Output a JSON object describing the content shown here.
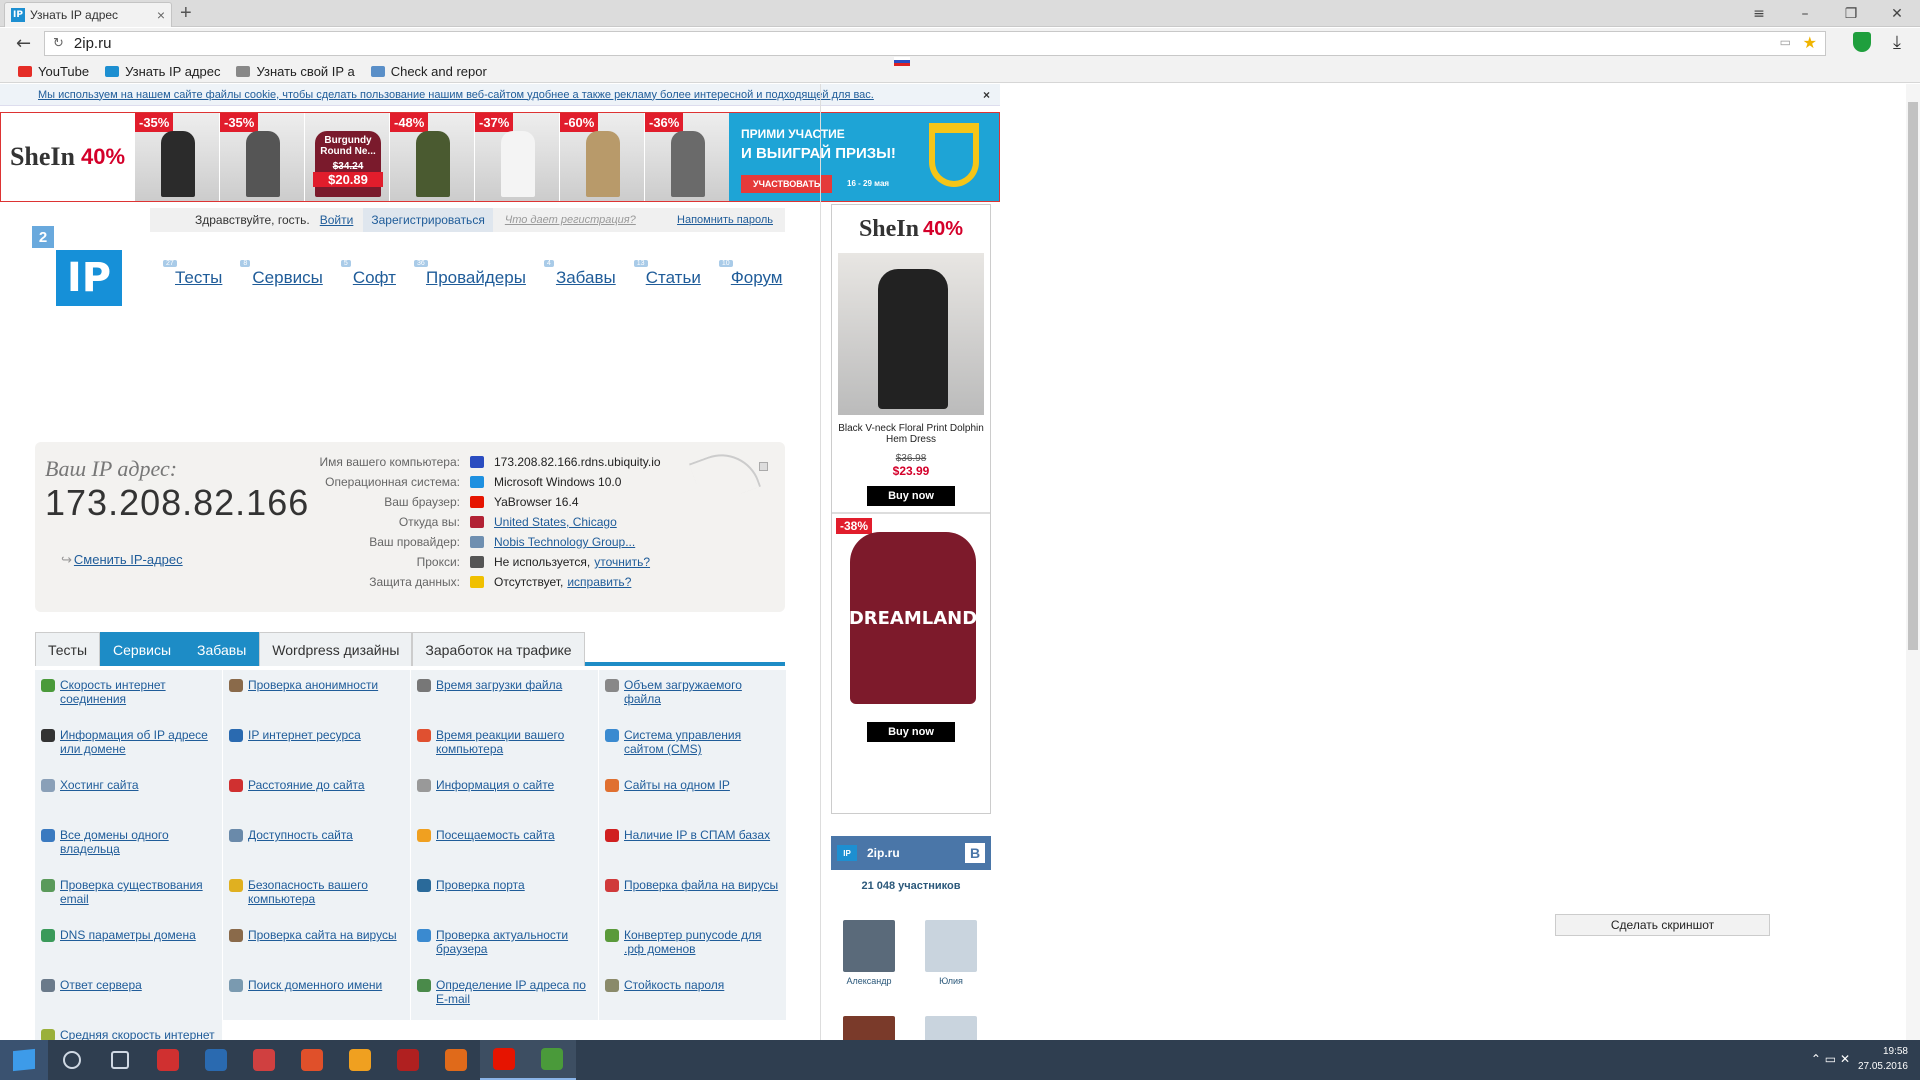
{
  "browser": {
    "tab_title": "Узнать IP адрес",
    "favicon_text": "IP",
    "close_glyph": "×",
    "newtab_glyph": "+",
    "address": "2ip.ru",
    "window_controls": [
      "≡",
      "–",
      "❐",
      "✕"
    ],
    "bookmarks": [
      {
        "label": "YouTube",
        "color": "#e52d27"
      },
      {
        "label": "Узнать IP адрес",
        "color": "#1d8fd1"
      },
      {
        "label": "Узнать свой IP а",
        "color": "#888888"
      },
      {
        "label": "Check and repor",
        "color": "#5a8fc8"
      }
    ]
  },
  "cookie_notice": {
    "text": "Мы используем на нашем сайте файлы cookie, чтобы сделать пользование нашим веб-сайтом удобнее а также рекламу более интересной и подходящей для вас.",
    "close": "×"
  },
  "banner": {
    "brand": "SheIn",
    "percent": "40%",
    "products": [
      {
        "discount": "-35%",
        "color": "#2b2b2b"
      },
      {
        "discount": "-35%",
        "color": "#555555"
      },
      {
        "discount": "",
        "color": "#7a1a2c",
        "label": "Burgundy Round Ne...",
        "old": "$34.24",
        "new": "$20.89"
      },
      {
        "discount": "-48%",
        "color": "#4a5a30"
      },
      {
        "discount": "-37%",
        "color": "#f4f4f4"
      },
      {
        "discount": "-60%",
        "color": "#b89a6a"
      },
      {
        "discount": "-36%",
        "color": "#6a6a6a"
      }
    ],
    "promo_line1": "ПРИМИ УЧАСТИЕ",
    "promo_line2": "И ВЫИГРАЙ ПРИЗЫ!",
    "promo_button": "УЧАСТВОВАТЬ",
    "promo_dates": "16 - 29 мая"
  },
  "userbar": {
    "greeting": "Здравствуйте, гость.",
    "login": "Войти",
    "register": "Зарегистрироваться",
    "why": "Что дает регистрация?",
    "remind": "Напомнить пароль"
  },
  "logo": {
    "badge": "2",
    "text": "IP"
  },
  "nav": [
    {
      "label": "Тесты",
      "count": "27"
    },
    {
      "label": "Сервисы",
      "count": "8"
    },
    {
      "label": "Софт",
      "count": "5"
    },
    {
      "label": "Провайдеры",
      "count": "36"
    },
    {
      "label": "Забавы",
      "count": "4"
    },
    {
      "label": "Статьи",
      "count": "13"
    },
    {
      "label": "Форум",
      "count": "10"
    }
  ],
  "ipinfo": {
    "label": "Ваш IP адрес:",
    "ip": "173.208.82.166",
    "change": "Сменить IP-адрес",
    "rows": [
      {
        "key": "Имя вашего компьютера:",
        "value": "173.208.82.166.rdns.ubiquity.io",
        "color": "#2a4cc0",
        "link": false
      },
      {
        "key": "Операционная система:",
        "value": "Microsoft Windows 10.0",
        "color": "#1e90e0",
        "link": false
      },
      {
        "key": "Ваш браузер:",
        "value": "YaBrowser 16.4",
        "color": "#e61400",
        "link": false
      },
      {
        "key": "Откуда вы:",
        "value": "United States, Chicago",
        "color": "#b22234",
        "link": true
      },
      {
        "key": "Ваш провайдер:",
        "value": "Nobis Technology Group...",
        "color": "#6f8fb0",
        "link": true
      },
      {
        "key": "Прокси:",
        "value": "Не используется,",
        "extra": "уточнить?",
        "color": "#555555",
        "link": false
      },
      {
        "key": "Защита данных:",
        "value": "Отсутствует,",
        "extra": "исправить?",
        "color": "#f0c000",
        "link": false
      }
    ]
  },
  "tabs": [
    {
      "label": "Тесты",
      "active": false
    },
    {
      "label": "Сервисы",
      "active": true
    },
    {
      "label": "Забавы",
      "active": true
    },
    {
      "label": "Wordpress дизайны",
      "active": false
    },
    {
      "label": "Заработок на трафике",
      "active": false
    }
  ],
  "services": [
    {
      "label": "Скорость интернет соединения",
      "color": "#4a9a3a"
    },
    {
      "label": "Проверка анонимности",
      "color": "#8a6a4a"
    },
    {
      "label": "Время загрузки файла",
      "color": "#777777"
    },
    {
      "label": "Объем загружаемого файла",
      "color": "#888888"
    },
    {
      "label": "Информация об IP адресе или домене",
      "color": "#333333"
    },
    {
      "label": "IP интернет ресурса",
      "color": "#2a6ab0"
    },
    {
      "label": "Время реакции вашего компьютера",
      "color": "#e05030"
    },
    {
      "label": "Система управления сайтом (CMS)",
      "color": "#3a8ad0"
    },
    {
      "label": "Хостинг сайта",
      "color": "#8aa0b8"
    },
    {
      "label": "Расстояние до сайта",
      "color": "#d03030"
    },
    {
      "label": "Информация о сайте",
      "color": "#999999"
    },
    {
      "label": "Сайты на одном IP",
      "color": "#e07030"
    },
    {
      "label": "Все домены одного владельца",
      "color": "#3a7ac0"
    },
    {
      "label": "Доступность сайта",
      "color": "#6a8aaa"
    },
    {
      "label": "Посещаемость сайта",
      "color": "#f0a020"
    },
    {
      "label": "Наличие IP в СПАМ базах",
      "color": "#d02020"
    },
    {
      "label": "Проверка существования email",
      "color": "#5a9a5a"
    },
    {
      "label": "Безопасность вашего компьютера",
      "color": "#e0b020"
    },
    {
      "label": "Проверка порта",
      "color": "#2a6a9a"
    },
    {
      "label": "Проверка файла на вирусы",
      "color": "#d03a3a"
    },
    {
      "label": "DNS параметры домена",
      "color": "#3a9a5a"
    },
    {
      "label": "Проверка сайта на вирусы",
      "color": "#8a6a4a"
    },
    {
      "label": "Проверка актуальности браузера",
      "color": "#3a8ad0"
    },
    {
      "label": "Конвертер punycode для .рф доменов",
      "color": "#5a9a3a"
    },
    {
      "label": "Ответ сервера",
      "color": "#6a7a8a"
    },
    {
      "label": "Поиск доменного имени",
      "color": "#7a9ab0"
    },
    {
      "label": "Определение IP адреса по E-mail",
      "color": "#4a8a4a"
    },
    {
      "label": "Стойкость пароля",
      "color": "#8a8a6a"
    },
    {
      "label": "Средняя скорость интернет",
      "color": "#9ab03a"
    }
  ],
  "sidebar": {
    "brand": "SheIn",
    "percent": "40%",
    "product1_name": "Black V-neck Floral Print Dolphin Hem Dress",
    "product1_old": "$36.98",
    "product1_new": "$23.99",
    "buy": "Buy now",
    "product2_discount": "-38%",
    "product2_print": "DREAMLAND",
    "vk_logo": "IP",
    "vk_title": "2ip.ru",
    "vk_badge": "В",
    "members": "21 048 участников",
    "member1": "Александр",
    "member2": "Юлия"
  },
  "screenshot_button": "Сделать скриншот",
  "taskbar": {
    "icons": [
      "#3d9be9",
      "#e8c05a",
      "#d03030",
      "#2a6ab0",
      "#d04040",
      "#e0502a",
      "#f0a020",
      "#b02020",
      "#e06a1a",
      "#e61400",
      "#4a9a3a"
    ],
    "time": "19:58",
    "date": "27.05.2016"
  }
}
